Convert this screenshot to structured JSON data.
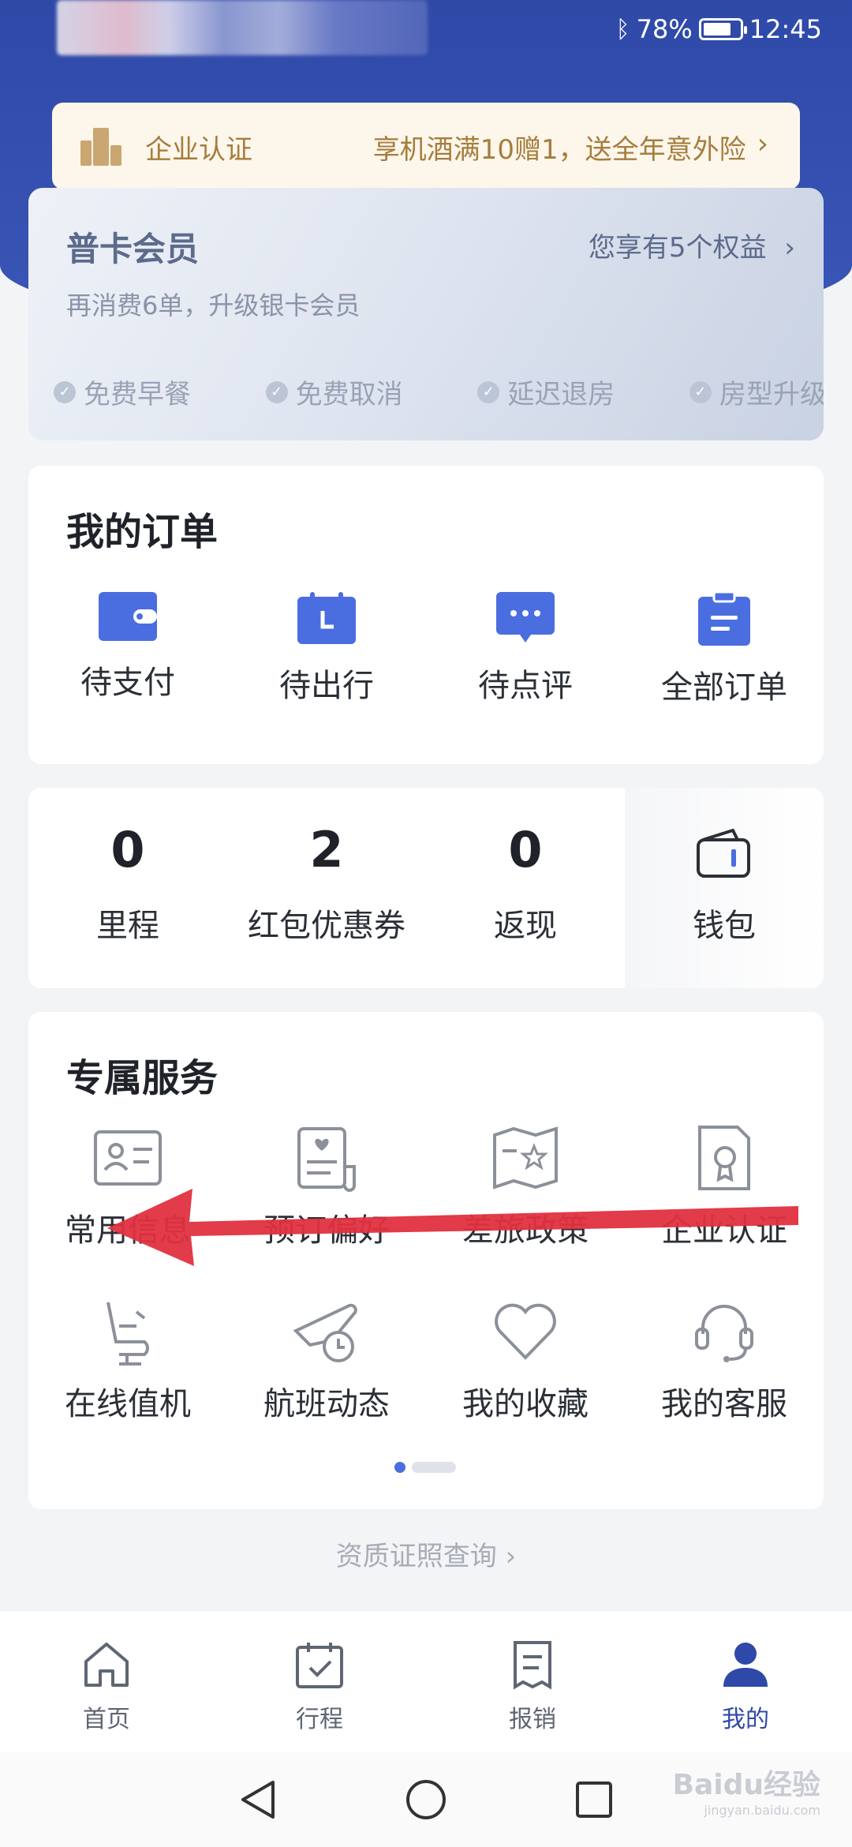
{
  "status_bar": {
    "battery": "78%",
    "time": "12:45"
  },
  "cert_banner": {
    "label": "企业认证",
    "promo": "享机酒满10赠1，送全年意外险"
  },
  "membership": {
    "title": "普卡会员",
    "benefits_count": "您享有5个权益",
    "upgrade_hint": "再消费6单，升级银卡会员",
    "benefits": [
      "免费早餐",
      "免费取消",
      "延迟退房",
      "房型升级"
    ]
  },
  "orders": {
    "title": "我的订单",
    "items": [
      {
        "label": "待支付",
        "icon": "wallet-card-icon"
      },
      {
        "label": "待出行",
        "icon": "calendar-icon"
      },
      {
        "label": "待点评",
        "icon": "chat-bubble-icon"
      },
      {
        "label": "全部订单",
        "icon": "clipboard-icon"
      }
    ]
  },
  "stats": {
    "items": [
      {
        "value": "0",
        "label": "里程"
      },
      {
        "value": "2",
        "label": "红包优惠券"
      },
      {
        "value": "0",
        "label": "返现"
      }
    ],
    "wallet_label": "钱包"
  },
  "services": {
    "title": "专属服务",
    "items": [
      {
        "label": "常用信息",
        "icon": "id-card-icon"
      },
      {
        "label": "预订偏好",
        "icon": "preference-doc-icon"
      },
      {
        "label": "差旅政策",
        "icon": "policy-map-icon"
      },
      {
        "label": "企业认证",
        "icon": "certificate-icon"
      },
      {
        "label": "在线值机",
        "icon": "seat-icon"
      },
      {
        "label": "航班动态",
        "icon": "plane-clock-icon"
      },
      {
        "label": "我的收藏",
        "icon": "heart-icon"
      },
      {
        "label": "我的客服",
        "icon": "headset-icon"
      }
    ]
  },
  "license_link": "资质证照查询",
  "tabbar": {
    "items": [
      {
        "label": "首页",
        "icon": "home-icon"
      },
      {
        "label": "行程",
        "icon": "calendar-check-icon"
      },
      {
        "label": "报销",
        "icon": "receipt-icon"
      },
      {
        "label": "我的",
        "icon": "person-icon"
      }
    ],
    "active_index": 3
  },
  "watermark": {
    "brand": "Baidu经验",
    "url": "jingyan.baidu.com"
  },
  "colors": {
    "primary": "#2f49a8",
    "accent_blue": "#4a6ee0",
    "gold": "#a57d3e",
    "annotation_arrow": "#e0303f"
  }
}
